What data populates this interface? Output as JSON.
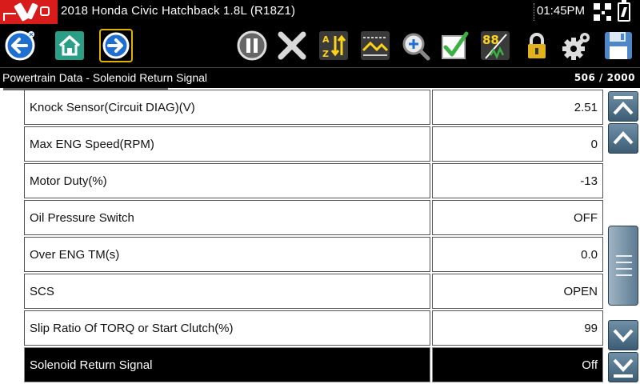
{
  "titlebar": {
    "vehicle": "2018 Honda Civic Hatchback 1.8L (R18Z1)",
    "time": "01:45PM"
  },
  "icons": {
    "logo": "scanner-logo-icon",
    "status": [
      "qr-code-icon",
      "battery-icon"
    ],
    "toolbar": [
      "back-icon",
      "home-icon",
      "forward-icon",
      "pause-icon",
      "close-icon",
      "sort-icon",
      "graph-icon",
      "zoom-icon",
      "checkmark-icon",
      "units-icon",
      "lock-icon",
      "settings-icon",
      "save-icon"
    ],
    "scroll": [
      "scroll-top-icon",
      "scroll-up-icon",
      "scroll-down-icon",
      "scroll-bottom-icon"
    ]
  },
  "toolbar": {
    "units_label": "88"
  },
  "colors": {
    "logo_red": "#d81c1c",
    "forward_highlight": "#e2b100",
    "button_blue": "#1e6fd0",
    "selected_row": "#000000"
  },
  "header": {
    "title": "Powertrain Data - Solenoid Return Signal",
    "counter": "506 / 2000"
  },
  "rows": [
    {
      "name": "Knock Sensor(Circuit DIAG)(V)",
      "value": "2.51"
    },
    {
      "name": "Max ENG Speed(RPM)",
      "value": "0"
    },
    {
      "name": "Motor Duty(%)",
      "value": "-13"
    },
    {
      "name": "Oil Pressure Switch",
      "value": "OFF"
    },
    {
      "name": "Over ENG TM(s)",
      "value": "0.0"
    },
    {
      "name": "SCS",
      "value": "OPEN"
    },
    {
      "name": "Slip Ratio Of TORQ or Start Clutch(%)",
      "value": "99"
    },
    {
      "name": "Solenoid Return Signal",
      "value": "Off",
      "selected": true
    }
  ],
  "scroll": {
    "position_fraction": 0.25
  }
}
